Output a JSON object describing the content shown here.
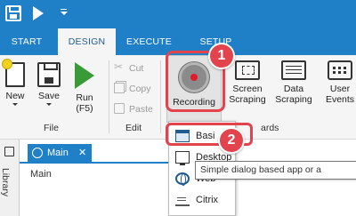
{
  "quick_access": {
    "icons": [
      "save-icon",
      "play-icon",
      "customize-dropdown-icon"
    ]
  },
  "ribbon_tabs": [
    {
      "label": "START"
    },
    {
      "label": "DESIGN",
      "active": true
    },
    {
      "label": "EXECUTE"
    },
    {
      "label": "SETUP"
    }
  ],
  "ribbon": {
    "file_group": {
      "new_label": "New",
      "save_label": "Save",
      "run_label": "Run",
      "run_shortcut": "(F5)",
      "group_label": "File"
    },
    "edit_group": {
      "cut_label": "Cut",
      "copy_label": "Copy",
      "paste_label": "Paste",
      "group_label": "Edit"
    },
    "wizards_group": {
      "recording_label": "Recording",
      "screen_scraping_line1": "Screen",
      "screen_scraping_line2": "Scraping",
      "data_scraping_line1": "Data",
      "data_scraping_line2": "Scraping",
      "user_events_line1": "User",
      "user_events_line2": "Events",
      "group_label": "ards"
    }
  },
  "recording_menu": {
    "items": [
      {
        "label": "Basi",
        "icon": "basic-window-icon"
      },
      {
        "label": "Desktop",
        "icon": "desktop-icon"
      },
      {
        "label": "Web",
        "icon": "web-globe-icon"
      },
      {
        "label": "Citrix",
        "icon": "citrix-icon"
      }
    ]
  },
  "tooltip": {
    "text": "Simple dialog based app or a"
  },
  "workspace": {
    "library_label": "Library",
    "doc_tab_label": "Main",
    "doc_tab_close": "✕",
    "content_label": "Main"
  },
  "callouts": {
    "step1": "1",
    "step2": "2"
  },
  "colors": {
    "accent": "#1f7fc7",
    "highlight": "#e2434d",
    "run_green": "#3a9a38",
    "record_red": "#e11b2b"
  }
}
